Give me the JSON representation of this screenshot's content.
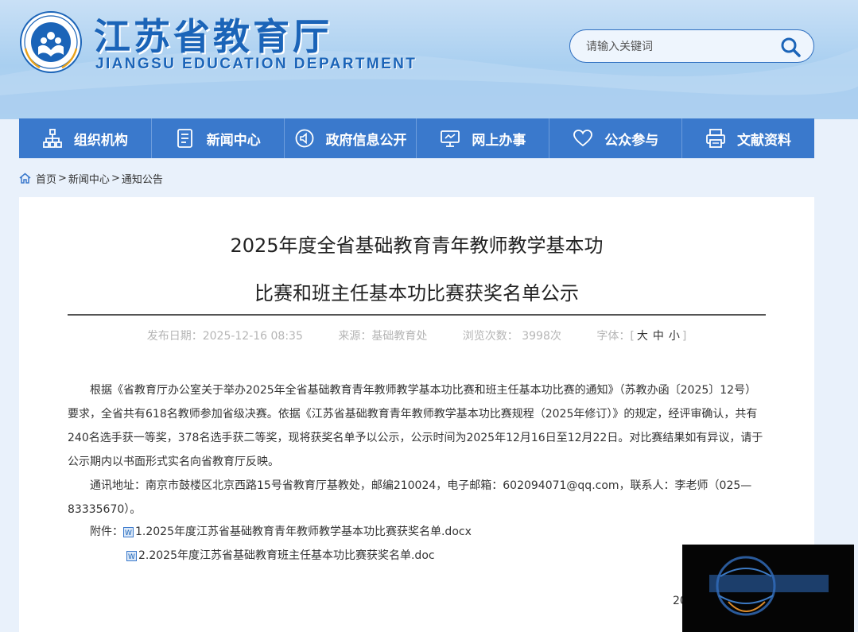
{
  "header": {
    "title_cn": "江苏省教育厅",
    "title_en": "JIANGSU EDUCATION DEPARTMENT",
    "logo_icon": "education-emblem-icon",
    "search": {
      "placeholder": "请输入关键词",
      "button_icon": "search-icon"
    }
  },
  "nav": [
    {
      "label": "组织机构",
      "icon": "org-chart-icon"
    },
    {
      "label": "新闻中心",
      "icon": "document-icon"
    },
    {
      "label": "政府信息公开",
      "icon": "speaker-icon"
    },
    {
      "label": "网上办事",
      "icon": "monitor-icon"
    },
    {
      "label": "公众参与",
      "icon": "heart-icon"
    },
    {
      "label": "文献资料",
      "icon": "printer-icon"
    }
  ],
  "breadcrumb": {
    "items": [
      "首页",
      "新闻中心",
      "通知公告"
    ],
    "sep": ">"
  },
  "article": {
    "title_line1": "2025年度全省基础教育青年教师教学基本功",
    "title_line2": "比赛和班主任基本功比赛获奖名单公示",
    "meta": {
      "publish": "发布日期：2025-12-16 08:35",
      "source": "来源：基础教育处",
      "views": "浏览次数： 3998次",
      "font_label": "字体：",
      "font_open": "[",
      "font_close": "]",
      "font_large": "大",
      "font_medium": "中",
      "font_small": "小"
    },
    "paragraph1": "根据《省教育厅办公室关于举办2025年全省基础教育青年教师教学基本功比赛和班主任基本功比赛的通知》（苏教办函〔2025〕12号）要求，全省共有618名教师参加省级决赛。依据《江苏省基础教育青年教师教学基本功比赛规程（2025年修订）》的规定，经评审确认，共有240名选手获一等奖，378名选手获二等奖，现将获奖名单予以公示，公示时间为2025年12月16日至12月22日。对比赛结果如有异议，请于公示期内以书面形式实名向省教育厅反映。",
    "paragraph2": "通讯地址：南京市鼓楼区北京西路15号省教育厅基教处，邮编210024，电子邮箱：602094071@qq.com，联系人：李老师（025—83335670）。",
    "attach_label": "附件：",
    "attachments": [
      "1.2025年度江苏省基础教育青年教师教学基本功比赛获奖名单.docx",
      "2.2025年度江苏省基础教育班主任基本功比赛获奖名单.doc"
    ],
    "date_fragment": "20"
  },
  "colors": {
    "brand_blue": "#1b64b8",
    "nav_blue": "#3a79cc",
    "header_bg": "#b6d6f2"
  }
}
